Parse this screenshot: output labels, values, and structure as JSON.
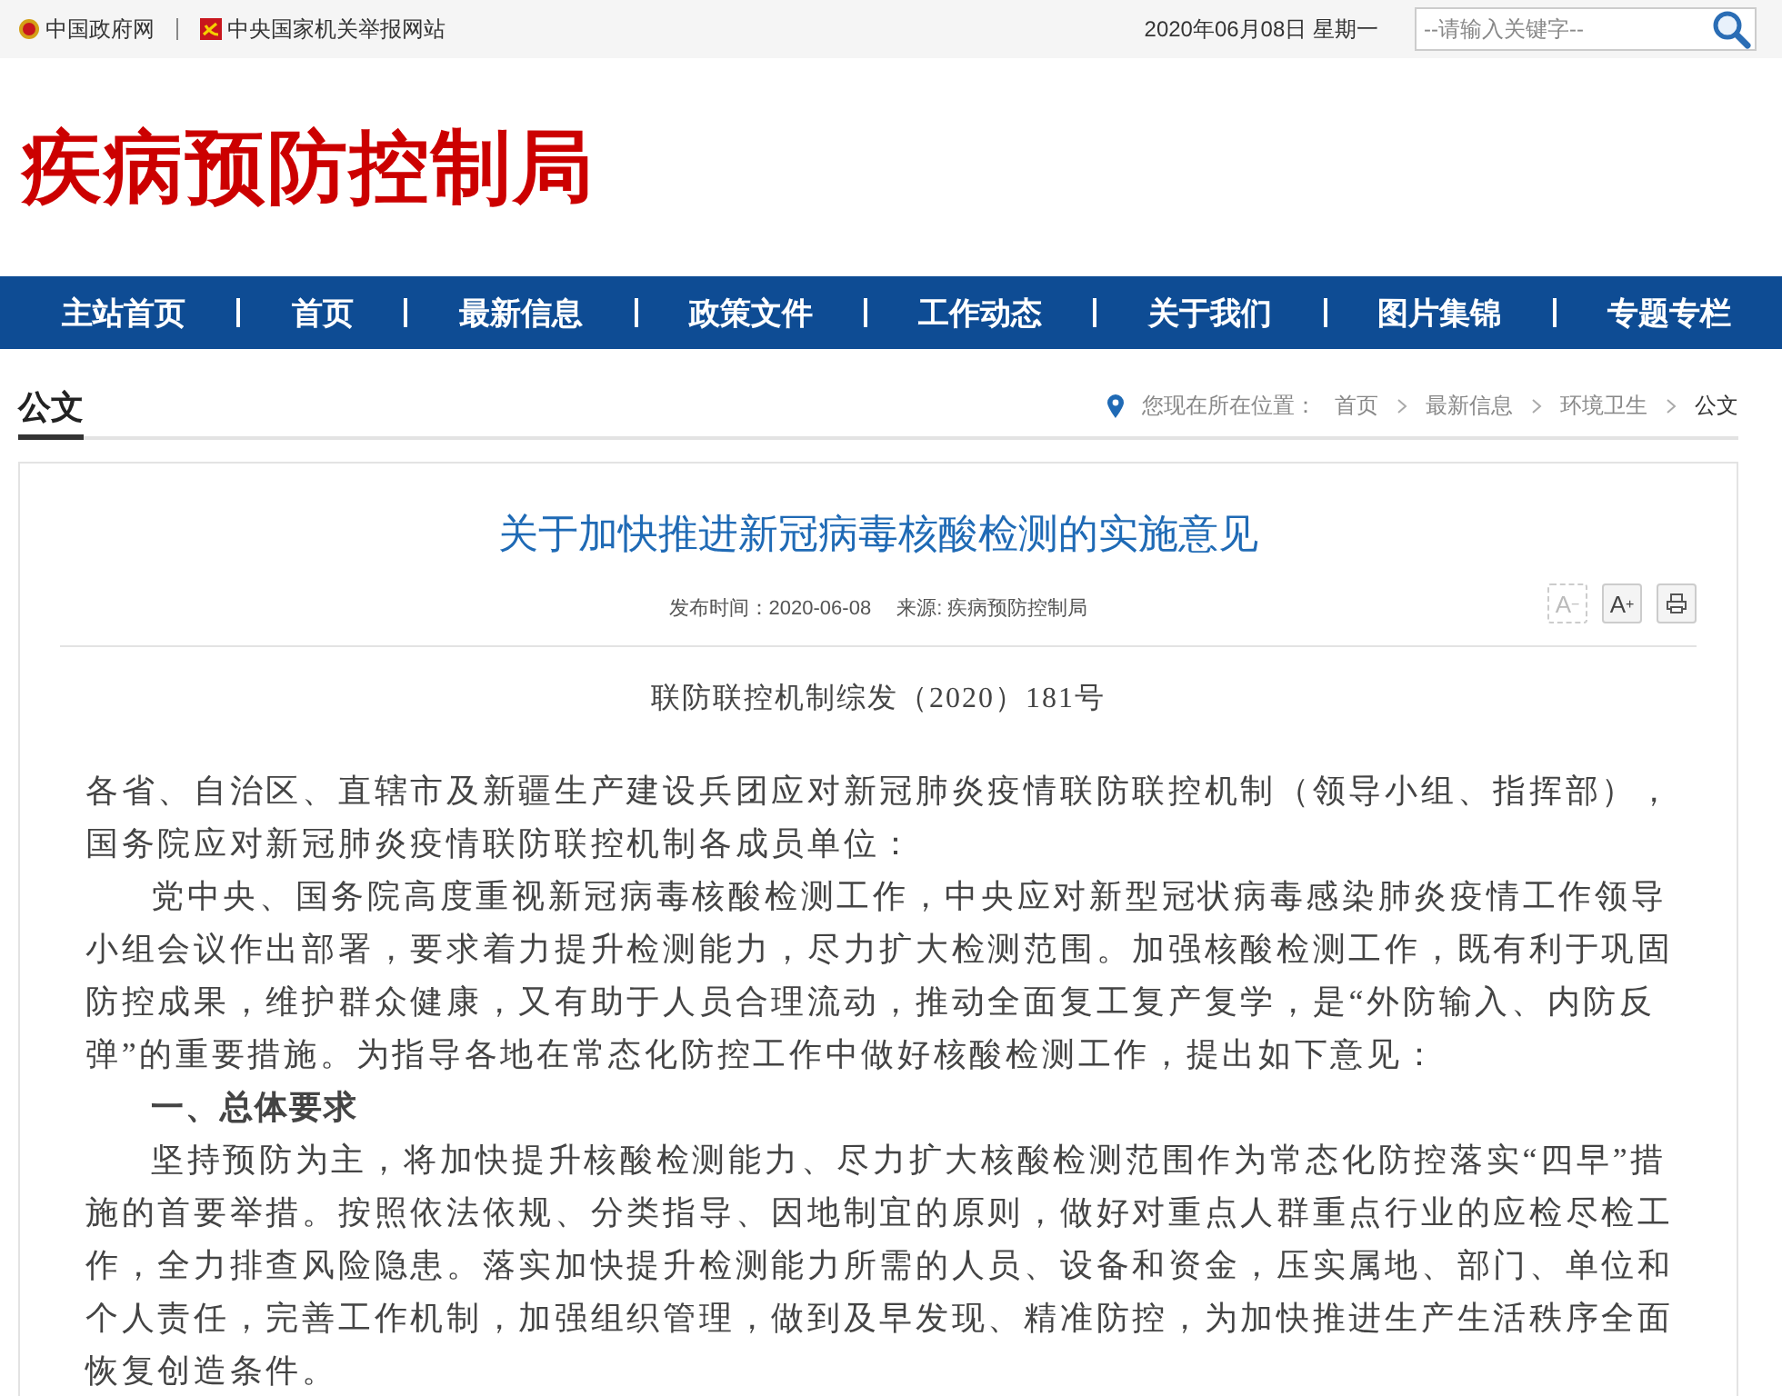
{
  "top_bar": {
    "links": [
      {
        "label": "中国政府网"
      },
      {
        "label": "中央国家机关举报网站"
      }
    ],
    "date": "2020年06月08日 星期一",
    "search": {
      "placeholder": "--请输入关键字--"
    }
  },
  "site_title": "疾病预防控制局",
  "nav": {
    "items": [
      "主站首页",
      "首页",
      "最新信息",
      "政策文件",
      "工作动态",
      "关于我们",
      "图片集锦",
      "专题专栏"
    ]
  },
  "section": {
    "title": "公文"
  },
  "breadcrumb": {
    "label": "您现在所在位置：",
    "items": [
      "首页",
      "最新信息",
      "环境卫生",
      "公文"
    ]
  },
  "article": {
    "title": "关于加快推进新冠病毒核酸检测的实施意见",
    "published": "发布时间：2020-06-08",
    "source": "来源: 疾病预防控制局",
    "tools": [
      {
        "kind": "font-smaller",
        "label": "A",
        "sup": "−",
        "disabled": true
      },
      {
        "kind": "font-larger",
        "label": "A",
        "sup": "+",
        "disabled": false
      },
      {
        "kind": "print",
        "disabled": false
      }
    ],
    "doc_number": "联防联控机制综发（2020）181号",
    "blocks": [
      {
        "kind": "address",
        "text": "各省、自治区、直辖市及新疆生产建设兵团应对新冠肺炎疫情联防联控机制（领导小组、指挥部），国务院应对新冠肺炎疫情联防联控机制各成员单位："
      },
      {
        "kind": "paragraph",
        "text": "党中央、国务院高度重视新冠病毒核酸检测工作，中央应对新型冠状病毒感染肺炎疫情工作领导小组会议作出部署，要求着力提升检测能力，尽力扩大检测范围。加强核酸检测工作，既有利于巩固防控成果，维护群众健康，又有助于人员合理流动，推动全面复工复产复学，是“外防输入、内防反弹”的重要措施。为指导各地在常态化防控工作中做好核酸检测工作，提出如下意见："
      },
      {
        "kind": "heading",
        "text": "一、总体要求"
      },
      {
        "kind": "paragraph",
        "text": "坚持预防为主，将加快提升核酸检测能力、尽力扩大核酸检测范围作为常态化防控落实“四早”措施的首要举措。按照依法依规、分类指导、因地制宜的原则，做好对重点人群重点行业的应检尽检工作，全力排查风险隐患。落实加快提升检测能力所需的人员、设备和资金，压实属地、部门、单位和个人责任，完善工作机制，加强组织管理，做到及早发现、精准防控，为加快推进生产生活秩序全面恢复创造条件。"
      }
    ]
  }
}
